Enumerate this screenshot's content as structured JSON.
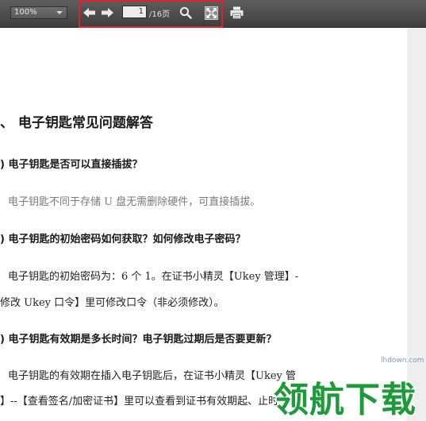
{
  "toolbar": {
    "zoom_value": "100%",
    "page_current": "1",
    "page_total": "/16页"
  },
  "document": {
    "section_title": "、 电子钥匙常见问题解答",
    "q1": ") 电子钥匙是否可以直接插拔？",
    "a1": "电子钥匙不同于存储 U 盘无需删除硬件，可直接插拔。",
    "q2": ") 电子钥匙的初始密码如何获取？如何修改电子密码？",
    "a2_line1": "电子钥匙的初始密码为：6 个 1。在证书小精灵【Ukey 管理】-",
    "a2_line2": "修改 Ukey 口令】里可修改口令（非必须修改）。",
    "q3": ") 电子钥匙有效期是多长时间？电子钥匙过期后是否要更新？",
    "a3_line1": "电子钥匙的有效期在插入电子钥匙后，在证书小精灵【Ukey 管",
    "a3_line2": "】--【查看签名/加密证书】里可以查看到证书有效期起、止时"
  },
  "watermark": {
    "site": "lhdown.com",
    "logo_text": "领航下载"
  },
  "colors": {
    "toolbar": "#4a4a4a",
    "highlight_box": "#e0202a",
    "logo_green": "#1f9a3a"
  }
}
